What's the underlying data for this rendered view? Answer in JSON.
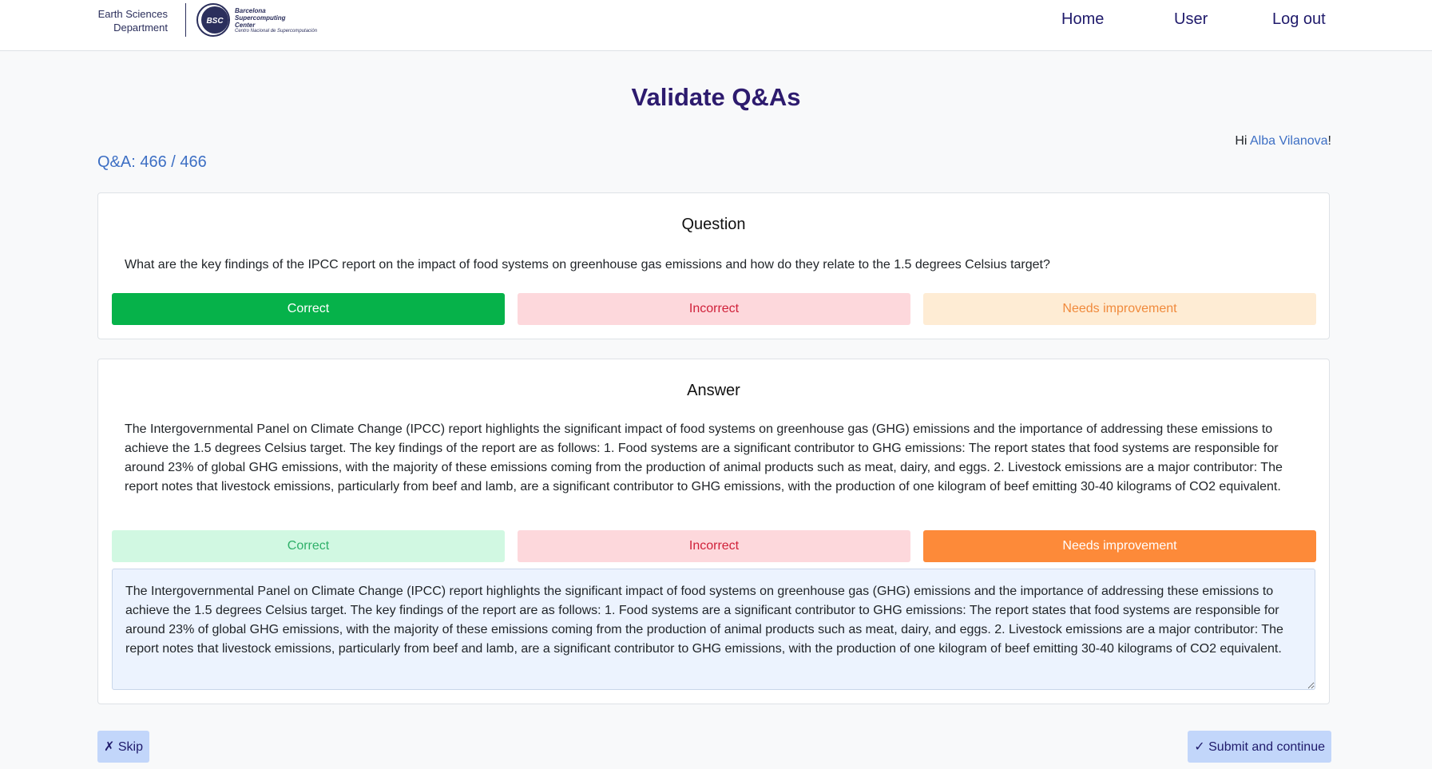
{
  "header": {
    "dept_name": "Earth Sciences Department",
    "bsc_logo_text": "Barcelona Supercomputing Center",
    "bsc_logo_badge": "BSC",
    "bsc_logo_sub": "Centro Nacional de Supercomputación",
    "nav": [
      {
        "label": "Home"
      },
      {
        "label": "User"
      },
      {
        "label": "Log out"
      }
    ]
  },
  "page": {
    "title": "Validate Q&As",
    "greeting_prefix": "Hi ",
    "user_name": "Alba Vilanova",
    "greeting_suffix": "!",
    "counter": "Q&A: 466 / 466"
  },
  "question": {
    "title": "Question",
    "text": "What are the key findings of the IPCC report on the impact of food systems on greenhouse gas emissions and how do they relate to the 1.5 degrees Celsius target?",
    "buttons": {
      "correct": "Correct",
      "incorrect": "Incorrect",
      "needs_improvement": "Needs improvement"
    },
    "selected": "correct"
  },
  "answer": {
    "title": "Answer",
    "text": "The Intergovernmental Panel on Climate Change (IPCC) report highlights the significant impact of food systems on greenhouse gas (GHG) emissions and the importance of addressing these emissions to achieve the 1.5 degrees Celsius target. The key findings of the report are as follows: 1. Food systems are a significant contributor to GHG emissions: The report states that food systems are responsible for around 23% of global GHG emissions, with the majority of these emissions coming from the production of animal products such as meat, dairy, and eggs. 2. Livestock emissions are a major contributor: The report notes that livestock emissions, particularly from beef and lamb, are a significant contributor to GHG emissions, with the production of one kilogram of beef emitting 30-40 kilograms of CO2 equivalent.",
    "buttons": {
      "correct": "Correct",
      "incorrect": "Incorrect",
      "needs_improvement": "Needs improvement"
    },
    "selected": "needs_improvement",
    "edit_value": "The Intergovernmental Panel on Climate Change (IPCC) report highlights the significant impact of food systems on greenhouse gas (GHG) emissions and the importance of addressing these emissions to achieve the 1.5 degrees Celsius target. The key findings of the report are as follows: 1. Food systems are a significant contributor to GHG emissions: The report states that food systems are responsible for around 23% of global GHG emissions, with the majority of these emissions coming from the production of animal products such as meat, dairy, and eggs. 2. Livestock emissions are a major contributor: The report notes that livestock emissions, particularly from beef and lamb, are a significant contributor to GHG emissions, with the production of one kilogram of beef emitting 30-40 kilograms of CO2 equivalent."
  },
  "actions": {
    "skip": "✗ Skip",
    "submit": "✓ Submit and continue"
  },
  "colors": {
    "primary_dark": "#2d1b6e",
    "link": "#3d6fc4",
    "correct_active": "#06b24a",
    "needs_active": "#fd8a39",
    "action_button": "#c2d6fa"
  }
}
